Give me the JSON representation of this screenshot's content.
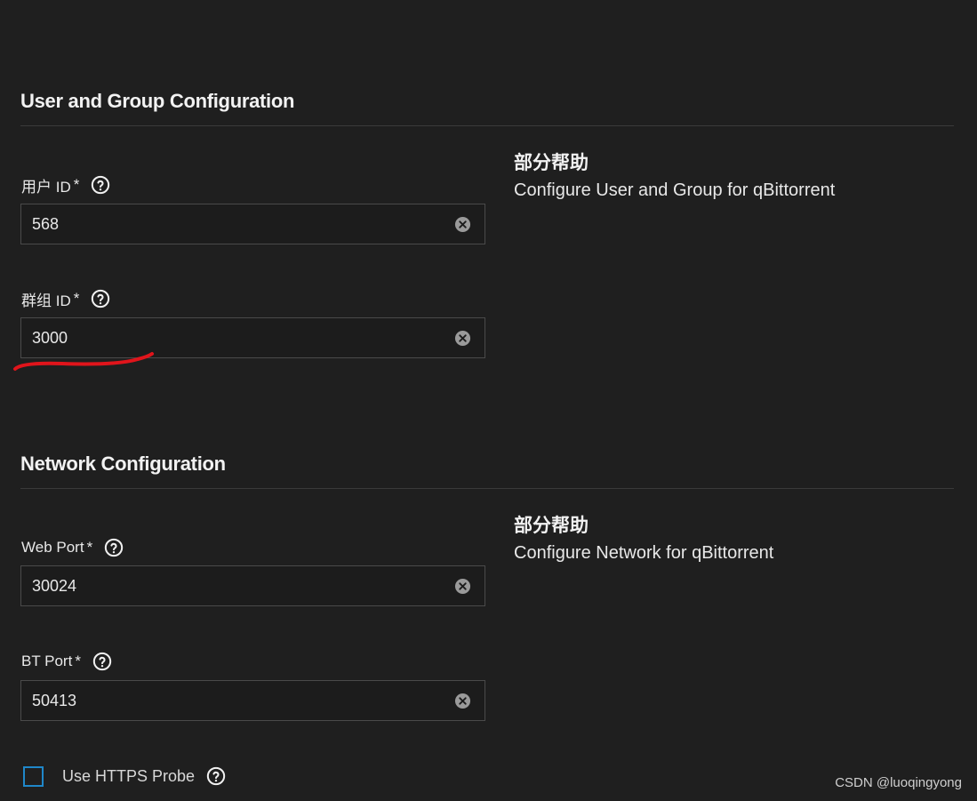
{
  "sections": {
    "user_group": {
      "title": "User and Group Configuration",
      "help_title": "部分帮助",
      "help_text": "Configure User and Group for qBittorrent",
      "fields": {
        "user_id": {
          "label": "用户 ID",
          "required": "*",
          "value": "568"
        },
        "group_id": {
          "label": "群组 ID",
          "required": "*",
          "value": "3000"
        }
      }
    },
    "network": {
      "title": "Network Configuration",
      "help_title": "部分帮助",
      "help_text": "Configure Network for qBittorrent",
      "fields": {
        "web_port": {
          "label": "Web Port",
          "required": "*",
          "value": "30024"
        },
        "bt_port": {
          "label": "BT Port",
          "required": "*",
          "value": "50413"
        }
      },
      "https_probe": {
        "label": "Use HTTPS Probe",
        "checked": false
      }
    }
  },
  "icons": {
    "help": "help-circle-icon",
    "clear": "clear-circle-icon"
  },
  "colors": {
    "background": "#1f1f1f",
    "checkbox_border": "#1f87c9",
    "annotation_stroke": "#e0141b"
  },
  "watermark": "CSDN @luoqingyong"
}
